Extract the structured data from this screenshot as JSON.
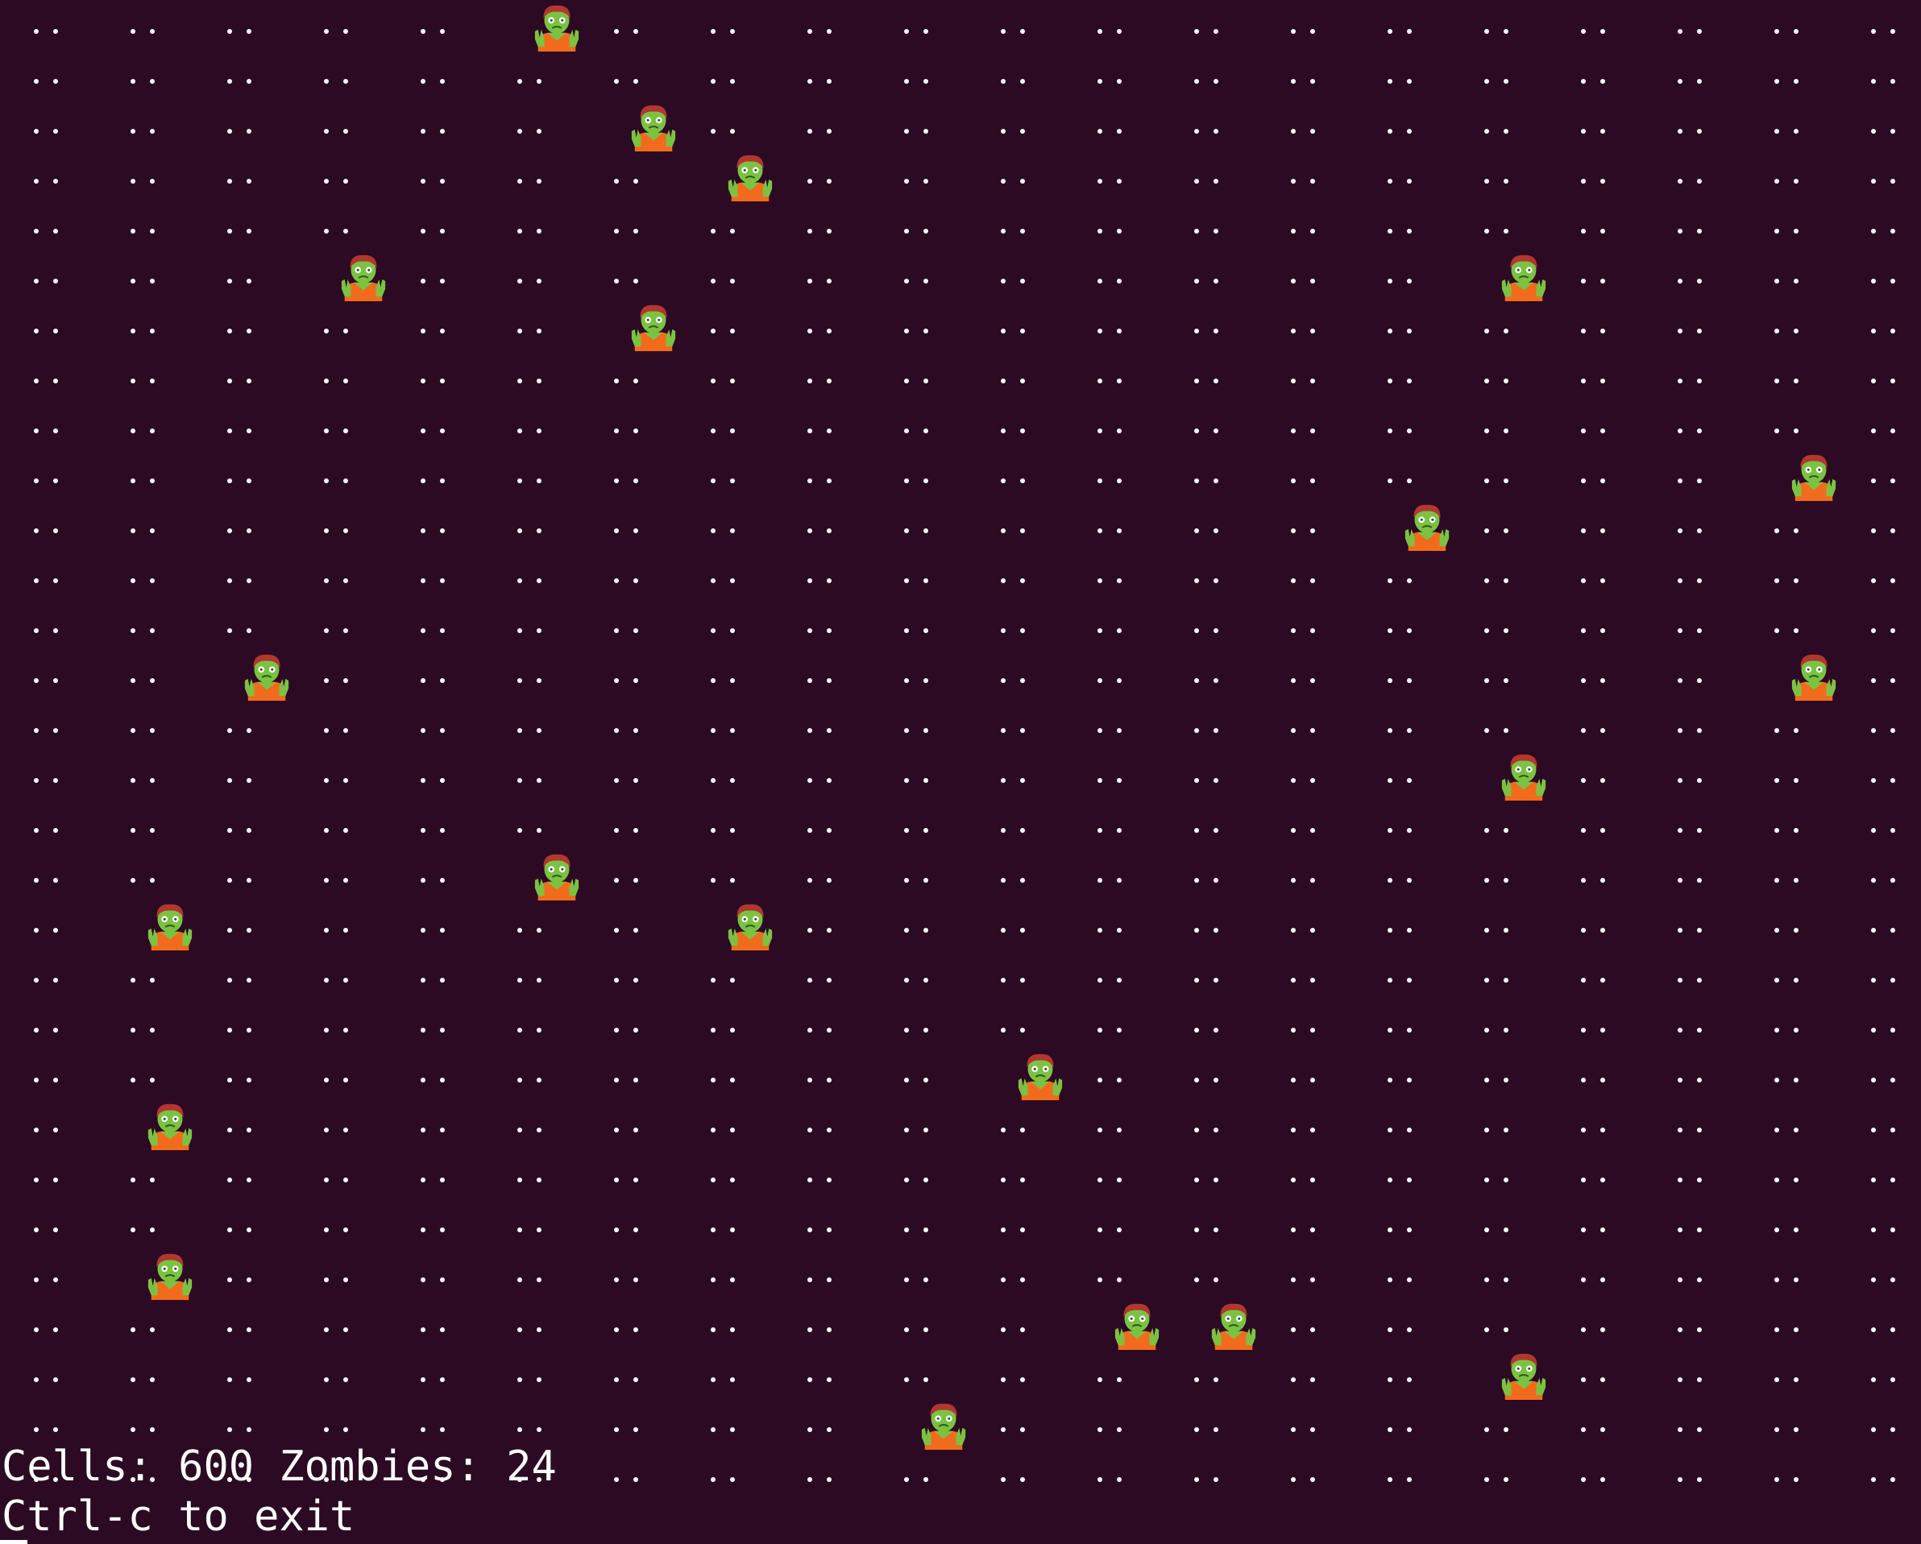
{
  "terminal": {
    "background": "#2c0a23",
    "foreground": "#ffffff",
    "grid": {
      "cols": 20,
      "rows": 30,
      "empty_glyph": "••",
      "zombie_icon": "zombie-emoji-icon",
      "zombies": [
        {
          "row": 0,
          "col": 5
        },
        {
          "row": 2,
          "col": 6
        },
        {
          "row": 3,
          "col": 7
        },
        {
          "row": 5,
          "col": 3
        },
        {
          "row": 5,
          "col": 15
        },
        {
          "row": 6,
          "col": 6
        },
        {
          "row": 9,
          "col": 18
        },
        {
          "row": 10,
          "col": 14
        },
        {
          "row": 13,
          "col": 2
        },
        {
          "row": 13,
          "col": 18
        },
        {
          "row": 15,
          "col": 15
        },
        {
          "row": 17,
          "col": 5
        },
        {
          "row": 18,
          "col": 1
        },
        {
          "row": 18,
          "col": 7
        },
        {
          "row": 21,
          "col": 10
        },
        {
          "row": 22,
          "col": 1
        },
        {
          "row": 25,
          "col": 1
        },
        {
          "row": 26,
          "col": 11
        },
        {
          "row": 26,
          "col": 12
        },
        {
          "row": 27,
          "col": 15
        },
        {
          "row": 28,
          "col": 9
        }
      ]
    },
    "status_line": "Cells: 600 Zombies: 24",
    "help_line": "Ctrl-c to exit"
  }
}
